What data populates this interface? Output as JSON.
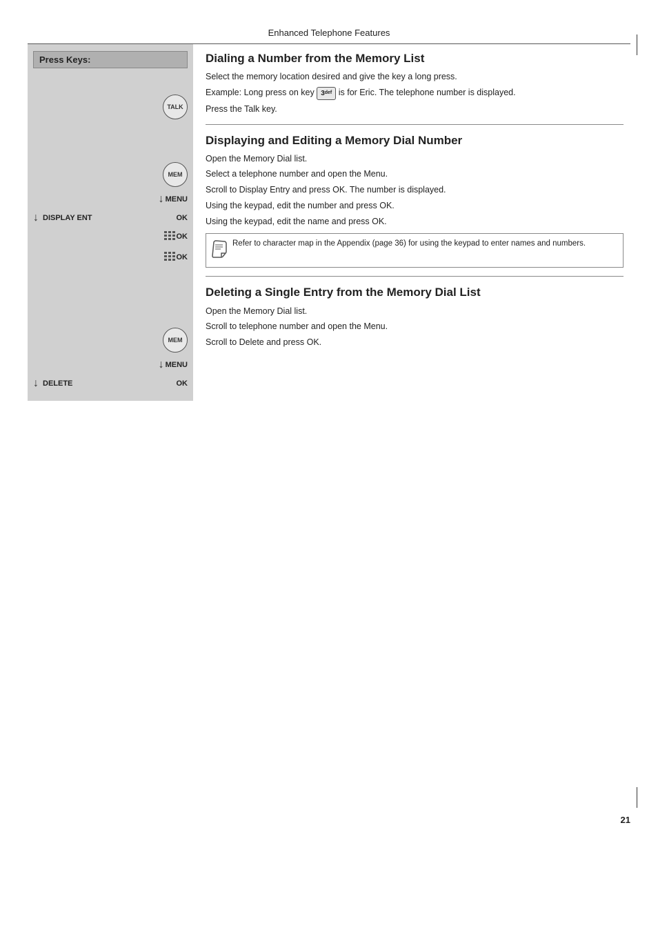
{
  "header": {
    "title": "Enhanced Telephone Features"
  },
  "left_panel": {
    "header": "Press Keys:"
  },
  "sections": [
    {
      "id": "dialing",
      "heading": "Dialing a Number from the Memory List",
      "instructions": [
        "Select the memory location desired and give the key a long press.",
        "Example: Long press on key  3  is for Eric. The telephone number is displayed.",
        "Press the Talk key."
      ]
    },
    {
      "id": "displaying",
      "heading": "Displaying and Editing a Memory Dial Number",
      "instructions": [
        "Open the Memory Dial list.",
        "Select a telephone number and open the Menu.",
        "Scroll to Display Entry and press OK. The number is displayed.",
        "Using the keypad, edit the number and press OK.",
        "Using the keypad, edit the name and press OK."
      ],
      "note": "Refer to character map in the Appendix (page 36) for using the keypad to enter names and numbers."
    }
  ],
  "section_delete": {
    "heading": "Deleting a Single Entry from the Memory Dial List",
    "instructions": [
      "Open the Memory Dial list.",
      "Scroll to telephone number and open the Menu.",
      "Scroll to Delete and press OK."
    ]
  },
  "page_number": "21",
  "keys": {
    "talk": "TALK",
    "mem": "MEM",
    "menu": "MENU",
    "ok": "OK",
    "display_ent": "DISPLAY ENT",
    "delete": "DELETE"
  }
}
